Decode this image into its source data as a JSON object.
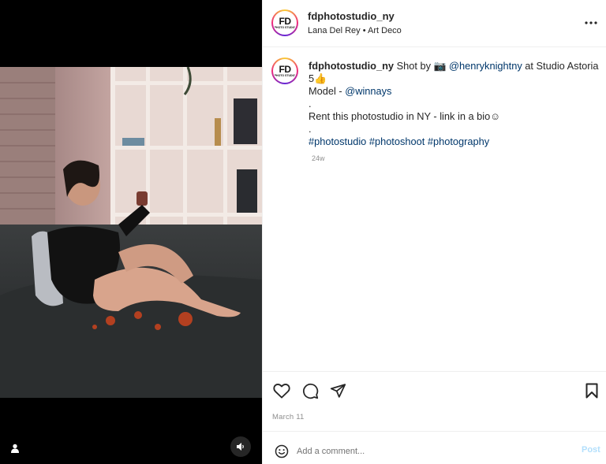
{
  "header": {
    "username": "fdphotostudio_ny",
    "music": "Lana Del Rey • Art Deco",
    "logo_text": "FD",
    "logo_subtext": "PHOTO STUDIO"
  },
  "caption": {
    "username": "fdphotostudio_ny",
    "shot_by": " Shot by 📷  ",
    "mention_photographer": "@henryknightny",
    "studio_text": " at Studio Astoria",
    "line1b": "5👍",
    "model_label": "Model - ",
    "mention_model": "@winnays",
    "dot1": ".",
    "rent": "Rent this photostudio in NY - link in a bio☺",
    "dot2": ".",
    "hashtags": "#photostudio #photoshoot #photography",
    "time": "24w"
  },
  "actions": {
    "date": "March 11"
  },
  "comment": {
    "placeholder": "Add a comment...",
    "post_label": "Post"
  },
  "colors": {
    "link": "#00376b",
    "muted": "#8e8e8e",
    "post_disabled": "#b2dffc"
  },
  "icons": [
    "more-icon",
    "heart-icon",
    "comment-icon",
    "share-icon",
    "bookmark-icon",
    "emoji-icon",
    "user-tag-icon",
    "audio-icon"
  ]
}
